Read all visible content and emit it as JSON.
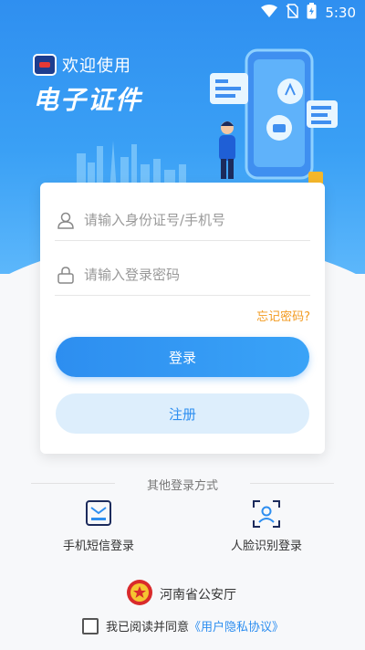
{
  "status_bar": {
    "time": "5:30",
    "icons": [
      "wifi-icon",
      "no-sim-icon",
      "battery-charging-icon"
    ]
  },
  "header": {
    "welcome": "欢迎使用",
    "title": "电子证件"
  },
  "login_form": {
    "id_placeholder": "请输入身份证号/手机号",
    "password_placeholder": "请输入登录密码",
    "forgot_password": "忘记密码?",
    "login_button": "登录",
    "register_button": "注册"
  },
  "other_login": {
    "title": "其他登录方式",
    "methods": [
      {
        "label": "手机短信登录",
        "icon": "sms-icon"
      },
      {
        "label": "人脸识别登录",
        "icon": "face-scan-icon"
      }
    ]
  },
  "footer": {
    "authority": "河南省公安厅",
    "agree_text": "我已阅读并同意",
    "agreement_link": "《用户隐私协议》",
    "agreed": false
  },
  "colors": {
    "primary": "#2d8ef0",
    "accent": "#f29a1f",
    "register_bg": "#ddeefc"
  }
}
